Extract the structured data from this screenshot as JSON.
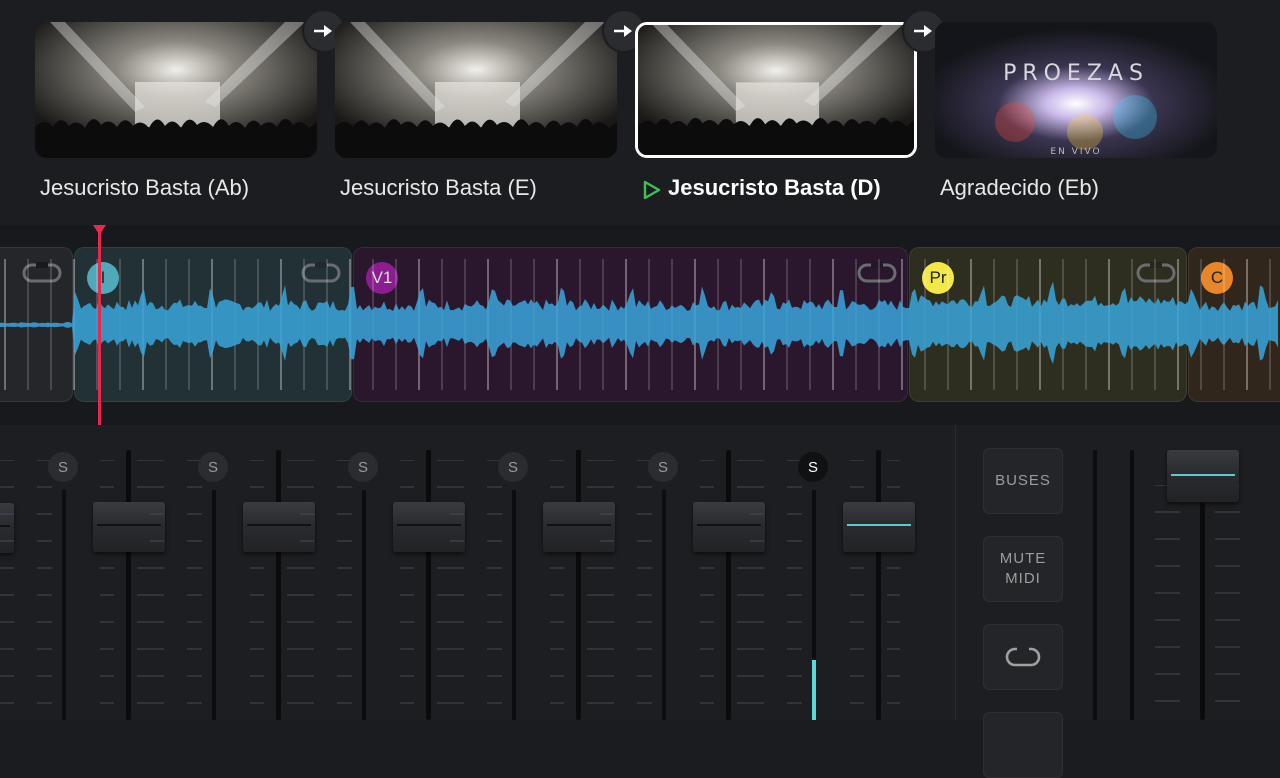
{
  "setlist": {
    "songs": [
      {
        "title": "Jesucristo Basta (Ab)",
        "active": false
      },
      {
        "title": "Jesucristo Basta (E)",
        "active": false
      },
      {
        "title": "Jesucristo Basta (D)",
        "active": true
      },
      {
        "title": "Agradecido (Eb)",
        "active": false
      }
    ],
    "album_art_text": "PROEZAS",
    "album_art_subtext": "EN VIVO",
    "colors": {
      "play": "#3fbf5a",
      "active_border": "#ffffff"
    }
  },
  "waveform": {
    "sections": [
      {
        "label": "",
        "color": "#3f4a48"
      },
      {
        "label": "I",
        "color": "#4fa9b8"
      },
      {
        "label": "V1",
        "color": "#8b1e8e"
      },
      {
        "label": "Pr",
        "color": "#f2e84a"
      },
      {
        "label": "C",
        "color": "#e8862a"
      }
    ],
    "wave_color": "#3aa6dc",
    "playhead_color": "#e8284e"
  },
  "mixer": {
    "solo_label": "S",
    "channels": [
      {
        "solo_on": false
      },
      {
        "solo_on": false
      },
      {
        "solo_on": false
      },
      {
        "solo_on": false
      },
      {
        "solo_on": false
      },
      {
        "solo_on": true
      }
    ],
    "buttons": {
      "buses": "BUSES",
      "mute_midi": "MUTE MIDI"
    },
    "accent": "#62c8cf"
  }
}
